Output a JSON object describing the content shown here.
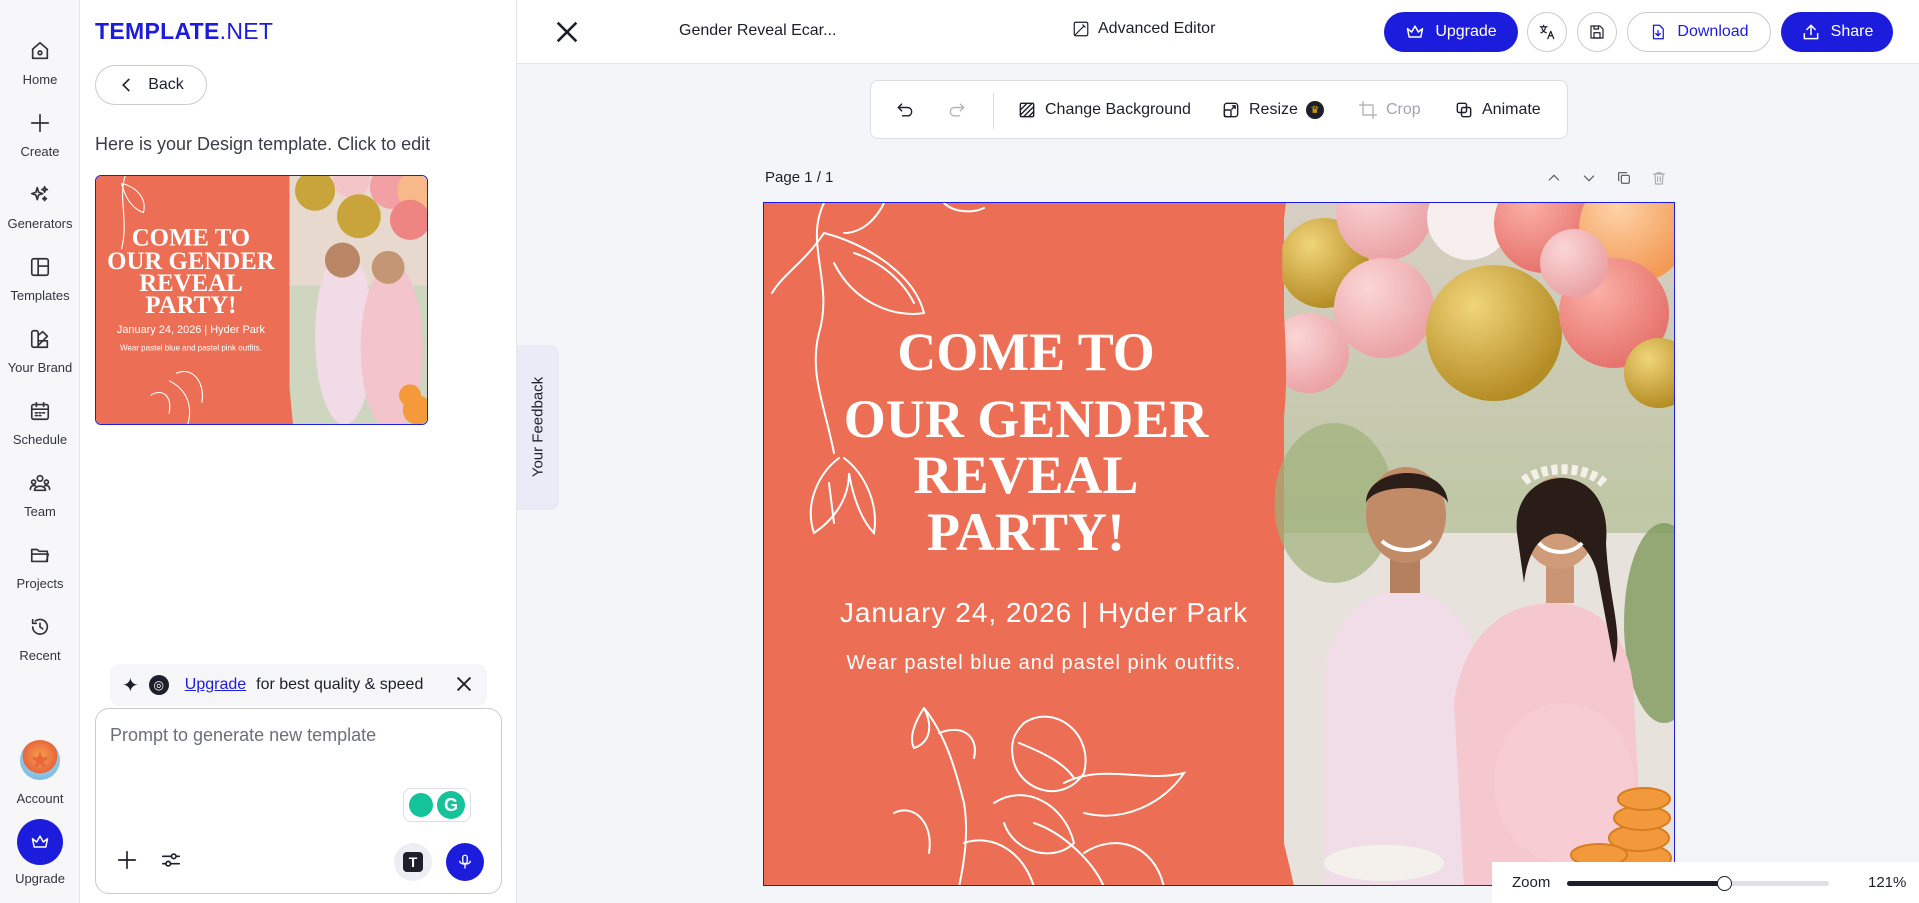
{
  "rail": {
    "items": [
      {
        "label": "Home",
        "icon": "home-icon"
      },
      {
        "label": "Create",
        "icon": "plus-icon"
      },
      {
        "label": "Generators",
        "icon": "sparkles-icon"
      },
      {
        "label": "Templates",
        "icon": "layout-icon"
      },
      {
        "label": "Your Brand",
        "icon": "palette-icon"
      },
      {
        "label": "Schedule",
        "icon": "calendar-icon"
      },
      {
        "label": "Team",
        "icon": "team-icon"
      },
      {
        "label": "Projects",
        "icon": "folder-icon"
      },
      {
        "label": "Recent",
        "icon": "history-icon"
      }
    ],
    "account_label": "Account",
    "upgrade_label": "Upgrade"
  },
  "panel": {
    "logo_main": "TEMPLATE",
    "logo_suffix": ".NET",
    "back_label": "Back",
    "hint": "Here is your Design template. Click to edit",
    "upsell": {
      "link": "Upgrade",
      "text": "for best quality & speed"
    },
    "prompt_placeholder": "Prompt to generate new template"
  },
  "topbar": {
    "doc_title": "Gender Reveal Ecar...",
    "advanced_editor": "Advanced Editor",
    "upgrade": "Upgrade",
    "download": "Download",
    "share": "Share"
  },
  "toolbar": {
    "change_background": "Change Background",
    "resize": "Resize",
    "crop": "Crop",
    "animate": "Animate"
  },
  "feedback_label": "Your Feedback",
  "page_label": "Page 1 / 1",
  "design": {
    "headline_1": "COME TO",
    "headline_2": "OUR GENDER",
    "headline_3": "REVEAL",
    "headline_4": "PARTY!",
    "date_line": "January 24, 2026 | Hyder Park",
    "dress_line": "Wear pastel blue and pastel pink outfits.",
    "bg_color": "#ec6e54"
  },
  "zoom": {
    "label": "Zoom",
    "value_text": "121%",
    "slider_fraction": 0.6
  },
  "colors": {
    "brand": "#1c1cdd",
    "coral": "#ec6e54"
  }
}
